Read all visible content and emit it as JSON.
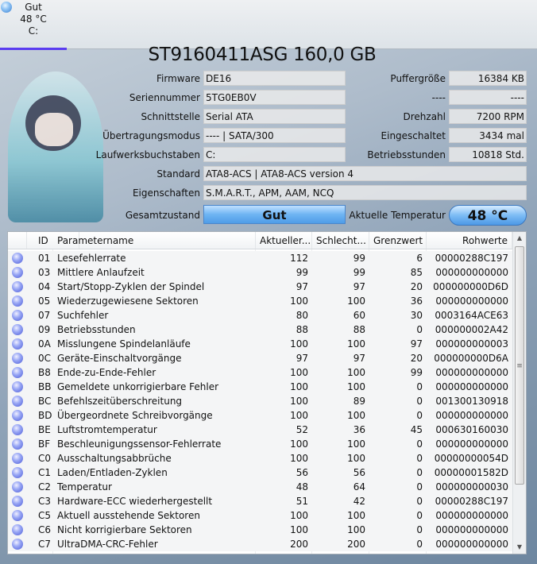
{
  "tab": {
    "status": "Gut",
    "temp": "48 °C",
    "drive": "C:"
  },
  "title": "ST9160411ASG 160,0 GB",
  "info_left": [
    {
      "label": "Firmware",
      "value": "DE16"
    },
    {
      "label": "Seriennummer",
      "value": "5TG0EB0V"
    },
    {
      "label": "Schnittstelle",
      "value": "Serial ATA"
    },
    {
      "label": "Übertragungsmodus",
      "value": "---- | SATA/300"
    },
    {
      "label": "Laufwerksbuchstaben",
      "value": "C:"
    }
  ],
  "info_right": [
    {
      "label": "Puffergröße",
      "value": "16384 KB"
    },
    {
      "label": "----",
      "value": "----"
    },
    {
      "label": "Drehzahl",
      "value": "7200 RPM"
    },
    {
      "label": "Eingeschaltet",
      "value": "3434 mal"
    },
    {
      "label": "Betriebsstunden",
      "value": "10818 Std."
    }
  ],
  "standard": {
    "label": "Standard",
    "value": "ATA8-ACS | ATA8-ACS version 4"
  },
  "features": {
    "label": "Eigenschaften",
    "value": "S.M.A.R.T., APM, AAM, NCQ"
  },
  "health": {
    "label": "Gesamtzustand",
    "value": "Gut"
  },
  "temperature": {
    "label": "Aktuelle Temperatur",
    "value": "48 °C"
  },
  "columns": [
    "ID",
    "Parametername",
    "Aktueller...",
    "Schlecht...",
    "Grenzwert",
    "Rohwerte"
  ],
  "rows": [
    [
      "01",
      "Lesefehlerrate",
      "112",
      "99",
      "6",
      "00000288C197"
    ],
    [
      "03",
      "Mittlere Anlaufzeit",
      "99",
      "99",
      "85",
      "000000000000"
    ],
    [
      "04",
      "Start/Stopp-Zyklen der Spindel",
      "97",
      "97",
      "20",
      "000000000D6D"
    ],
    [
      "05",
      "Wiederzugewiesene Sektoren",
      "100",
      "100",
      "36",
      "000000000000"
    ],
    [
      "07",
      "Suchfehler",
      "80",
      "60",
      "30",
      "0003164ACE63"
    ],
    [
      "09",
      "Betriebsstunden",
      "88",
      "88",
      "0",
      "000000002A42"
    ],
    [
      "0A",
      "Misslungene Spindelanläufe",
      "100",
      "100",
      "97",
      "000000000003"
    ],
    [
      "0C",
      "Geräte-Einschaltvorgänge",
      "97",
      "97",
      "20",
      "000000000D6A"
    ],
    [
      "B8",
      "Ende-zu-Ende-Fehler",
      "100",
      "100",
      "99",
      "000000000000"
    ],
    [
      "BB",
      "Gemeldete unkorrigierbare Fehler",
      "100",
      "100",
      "0",
      "000000000000"
    ],
    [
      "BC",
      "Befehlszeitüberschreitung",
      "100",
      "89",
      "0",
      "001300130918"
    ],
    [
      "BD",
      "Übergeordnete Schreibvorgänge",
      "100",
      "100",
      "0",
      "000000000000"
    ],
    [
      "BE",
      "Luftstromtemperatur",
      "52",
      "36",
      "45",
      "000630160030"
    ],
    [
      "BF",
      "Beschleunigungssensor-Fehlerrate",
      "100",
      "100",
      "0",
      "000000000000"
    ],
    [
      "C0",
      "Ausschaltungsabbrüche",
      "100",
      "100",
      "0",
      "00000000054D"
    ],
    [
      "C1",
      "Laden/Entladen-Zyklen",
      "56",
      "56",
      "0",
      "00000001582D"
    ],
    [
      "C2",
      "Temperatur",
      "48",
      "64",
      "0",
      "000000000030"
    ],
    [
      "C3",
      "Hardware-ECC wiederhergestellt",
      "51",
      "42",
      "0",
      "00000288C197"
    ],
    [
      "C5",
      "Aktuell ausstehende Sektoren",
      "100",
      "100",
      "0",
      "000000000000"
    ],
    [
      "C6",
      "Nicht korrigierbare Sektoren",
      "100",
      "100",
      "0",
      "000000000000"
    ],
    [
      "C7",
      "UltraDMA-CRC-Fehler",
      "200",
      "200",
      "0",
      "000000000000"
    ]
  ]
}
